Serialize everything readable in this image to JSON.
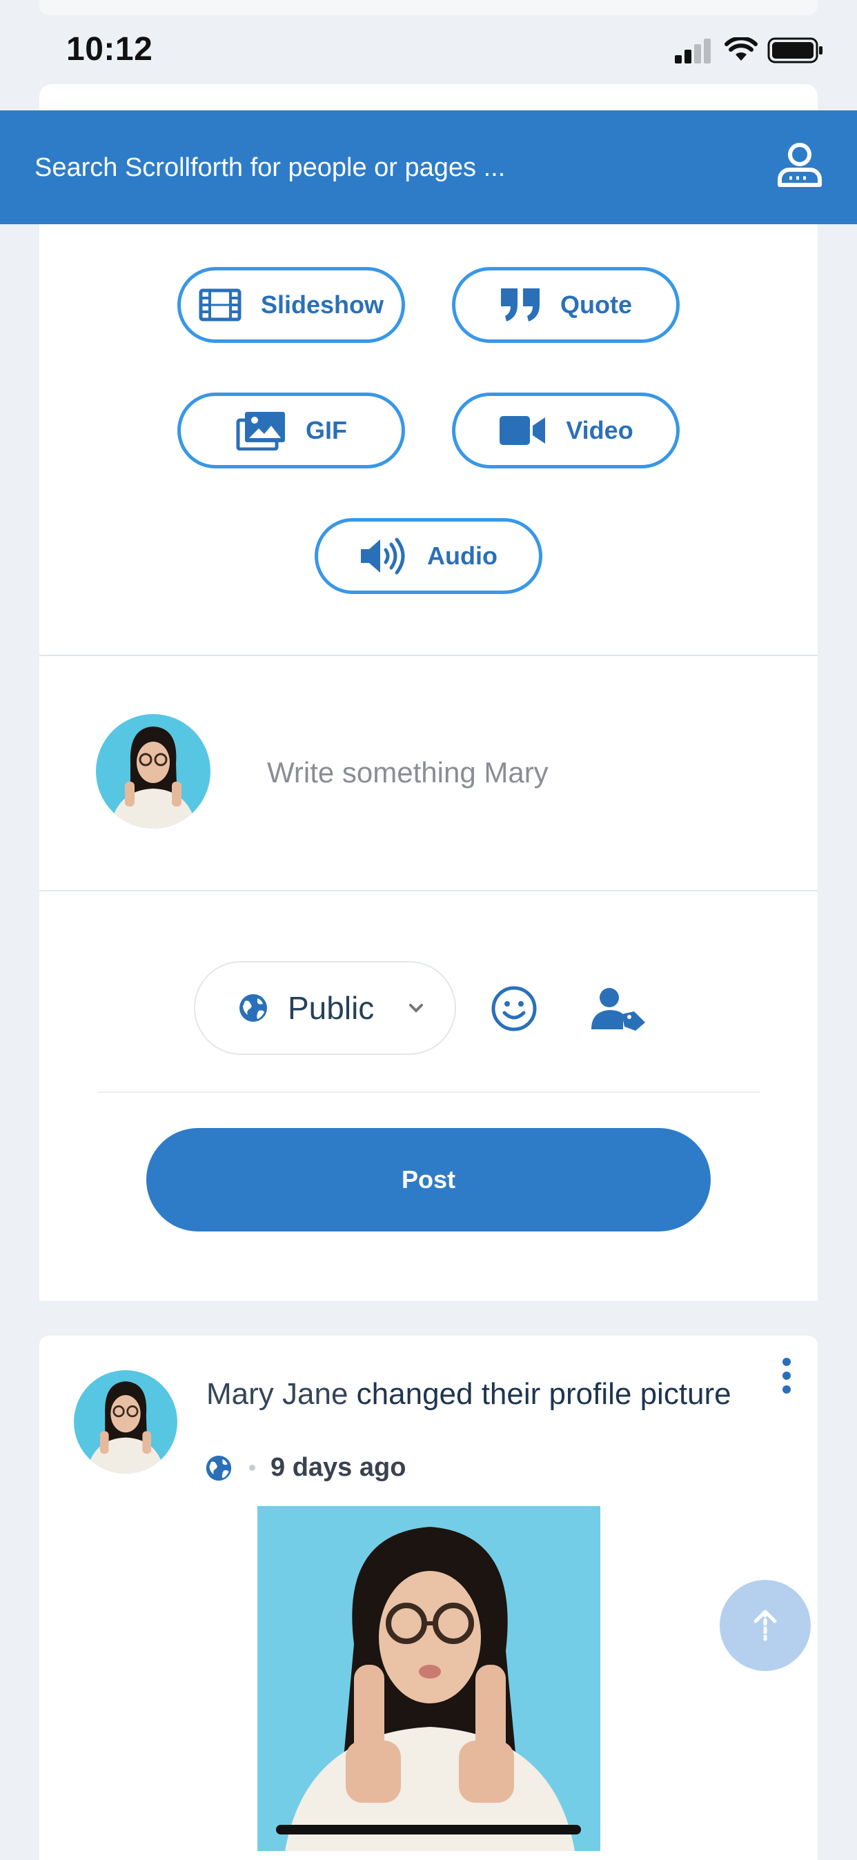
{
  "status_bar": {
    "time": "10:12"
  },
  "search": {
    "placeholder": "Search Scrollforth for people or pages ..."
  },
  "composer": {
    "media_buttons": [
      {
        "label": "Slideshow",
        "icon": "film-icon"
      },
      {
        "label": "Quote",
        "icon": "quote-icon"
      },
      {
        "label": "GIF",
        "icon": "images-icon"
      },
      {
        "label": "Video",
        "icon": "video-camera-icon"
      },
      {
        "label": "Audio",
        "icon": "volume-icon"
      }
    ],
    "write_placeholder": "Write something Mary",
    "privacy": "Public",
    "post_label": "Post"
  },
  "feed": {
    "post": {
      "author": "Mary Jane",
      "action": "changed their profile picture",
      "time": "9 days ago"
    }
  },
  "colors": {
    "brand_blue": "#2e7cc7",
    "outline_blue": "#3897e8",
    "page_bg": "#edf1f6"
  }
}
